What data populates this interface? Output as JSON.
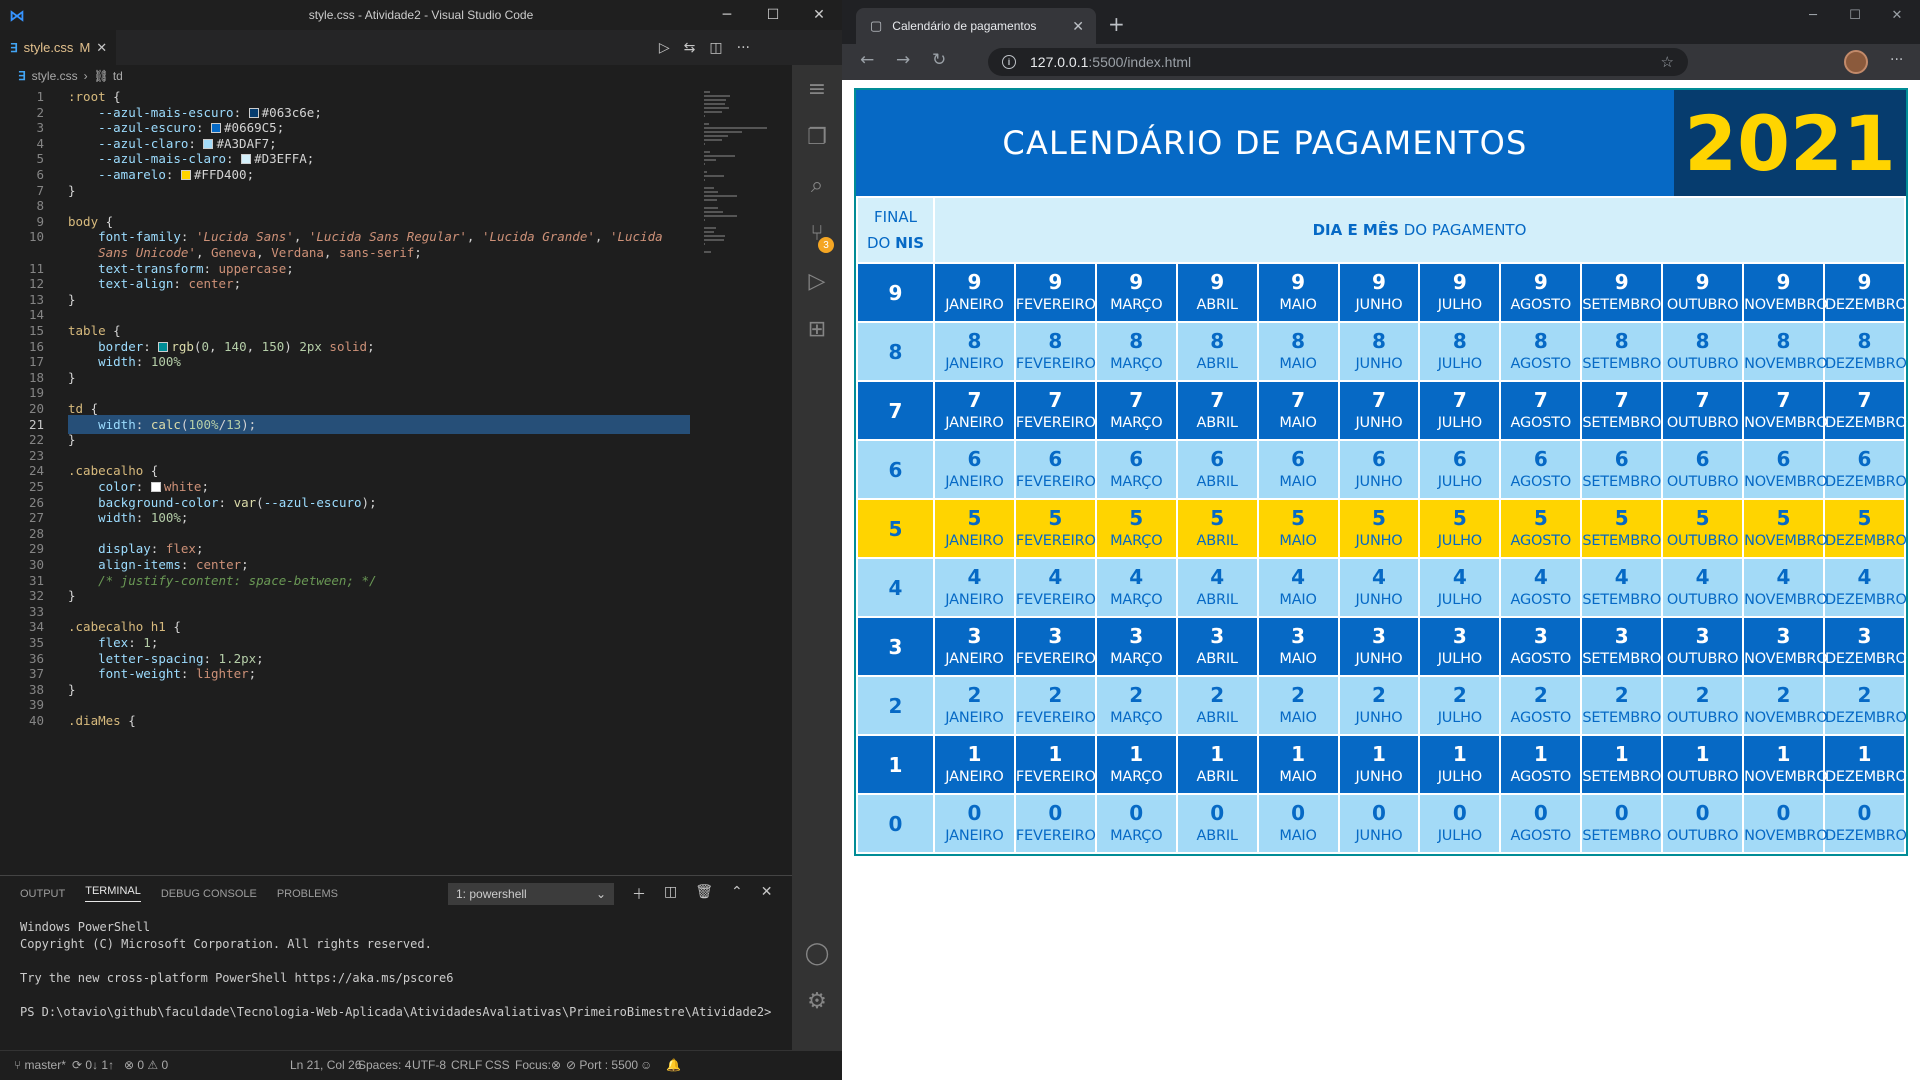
{
  "vscode": {
    "title": "style.css - Atividade2 - Visual Studio Code",
    "tab": {
      "filename": "style.css",
      "modified": "M"
    },
    "breadcrumb": {
      "file": "style.css",
      "symbol": "td"
    },
    "code_lines": [
      {
        "n": "1",
        "html": "<span class=\"c-sel\">:root</span> <span class=\"c-p\">{</span>"
      },
      {
        "n": "2",
        "html": "    <span class=\"c-prop\">--azul-mais-escuro</span><span class=\"c-p\">:</span> <span class=\"swatch\" style=\"background:#063c6e\"></span><span class=\"c-p\">#063c6e;</span>"
      },
      {
        "n": "3",
        "html": "    <span class=\"c-prop\">--azul-escuro</span><span class=\"c-p\">:</span> <span class=\"swatch\" style=\"background:#0669C5\"></span><span class=\"c-p\">#0669C5;</span>"
      },
      {
        "n": "4",
        "html": "    <span class=\"c-prop\">--azul-claro</span><span class=\"c-p\">:</span> <span class=\"swatch\" style=\"background:#A3DAF7\"></span><span class=\"c-p\">#A3DAF7;</span>"
      },
      {
        "n": "5",
        "html": "    <span class=\"c-prop\">--azul-mais-claro</span><span class=\"c-p\">:</span> <span class=\"swatch\" style=\"background:#D3EFFA\"></span><span class=\"c-p\">#D3EFFA;</span>"
      },
      {
        "n": "6",
        "html": "    <span class=\"c-prop\">--amarelo</span><span class=\"c-p\">:</span> <span class=\"swatch\" style=\"background:#FFD400\"></span><span class=\"c-p\">#FFD400;</span>"
      },
      {
        "n": "7",
        "html": "<span class=\"c-p\">}</span>"
      },
      {
        "n": "8",
        "html": ""
      },
      {
        "n": "9",
        "html": "<span class=\"c-sel\">body</span> <span class=\"c-p\">{</span>"
      },
      {
        "n": "10",
        "html": "    <span class=\"c-prop\">font-family</span><span class=\"c-p\">:</span> <span class=\"c-str\"><i>'Lucida Sans'</i></span><span class=\"c-p\">,</span> <span class=\"c-str\"><i>'Lucida Sans Regular'</i></span><span class=\"c-p\">,</span> <span class=\"c-str\"><i>'Lucida Grande'</i></span><span class=\"c-p\">,</span> <span class=\"c-str\"><i>'Lucida</i></span>"
      },
      {
        "n": "",
        "html": "    <span class=\"c-str\"><i>Sans Unicode'</i></span><span class=\"c-p\">,</span> <span class=\"c-val\">Geneva</span><span class=\"c-p\">,</span> <span class=\"c-val\">Verdana</span><span class=\"c-p\">,</span> <span class=\"c-val\">sans-serif</span><span class=\"c-p\">;</span>"
      },
      {
        "n": "11",
        "html": "    <span class=\"c-prop\">text-transform</span><span class=\"c-p\">:</span> <span class=\"c-val\">uppercase</span><span class=\"c-p\">;</span>"
      },
      {
        "n": "12",
        "html": "    <span class=\"c-prop\">text-align</span><span class=\"c-p\">:</span> <span class=\"c-val\">center</span><span class=\"c-p\">;</span>"
      },
      {
        "n": "13",
        "html": "<span class=\"c-p\">}</span>"
      },
      {
        "n": "14",
        "html": ""
      },
      {
        "n": "15",
        "html": "<span class=\"c-sel\">table</span> <span class=\"c-p\">{</span>"
      },
      {
        "n": "16",
        "html": "    <span class=\"c-prop\">border</span><span class=\"c-p\">:</span> <span class=\"swatch\" style=\"background:rgb(0,140,150)\"></span><span class=\"c-fn\">rgb</span><span class=\"c-p\">(</span><span class=\"c-num\">0</span><span class=\"c-p\">,</span> <span class=\"c-num\">140</span><span class=\"c-p\">,</span> <span class=\"c-num\">150</span><span class=\"c-p\">)</span> <span class=\"c-num\">2px</span> <span class=\"c-val\">solid</span><span class=\"c-p\">;</span>"
      },
      {
        "n": "17",
        "html": "    <span class=\"c-prop\">width</span><span class=\"c-p\">:</span> <span class=\"c-num\">100%</span>"
      },
      {
        "n": "18",
        "html": "<span class=\"c-p\">}</span>"
      },
      {
        "n": "19",
        "html": ""
      },
      {
        "n": "20",
        "html": "<span class=\"c-sel\">td</span> <span class=\"c-p\">{</span>"
      },
      {
        "n": "21",
        "html": "    <span class=\"c-prop\">width</span><span class=\"c-p\">:</span> <span class=\"c-fn\">calc</span><span class=\"c-p\">(</span><span class=\"c-num\">100%</span><span class=\"c-p\">/</span><span class=\"c-num\">13</span><span class=\"c-p\">);</span>",
        "active": true
      },
      {
        "n": "22",
        "html": "<span class=\"c-p\">}</span>"
      },
      {
        "n": "23",
        "html": ""
      },
      {
        "n": "24",
        "html": "<span class=\"c-sel\">.cabecalho</span> <span class=\"c-p\">{</span>"
      },
      {
        "n": "25",
        "html": "    <span class=\"c-prop\">color</span><span class=\"c-p\">:</span> <span class=\"swatch\" style=\"background:#ffffff\"></span><span class=\"c-val\">white</span><span class=\"c-p\">;</span>"
      },
      {
        "n": "26",
        "html": "    <span class=\"c-prop\">background-color</span><span class=\"c-p\">:</span> <span class=\"c-fn\">var</span><span class=\"c-p\">(</span><span class=\"c-prop\">--azul-escuro</span><span class=\"c-p\">);</span>"
      },
      {
        "n": "27",
        "html": "    <span class=\"c-prop\">width</span><span class=\"c-p\">:</span> <span class=\"c-num\">100%</span><span class=\"c-p\">;</span>"
      },
      {
        "n": "28",
        "html": ""
      },
      {
        "n": "29",
        "html": "    <span class=\"c-prop\">display</span><span class=\"c-p\">:</span> <span class=\"c-val\">flex</span><span class=\"c-p\">;</span>"
      },
      {
        "n": "30",
        "html": "    <span class=\"c-prop\">align-items</span><span class=\"c-p\">:</span> <span class=\"c-val\">center</span><span class=\"c-p\">;</span>"
      },
      {
        "n": "31",
        "html": "    <span class=\"c-com\">/* justify-content: space-between; */</span>"
      },
      {
        "n": "32",
        "html": "<span class=\"c-p\">}</span>"
      },
      {
        "n": "33",
        "html": ""
      },
      {
        "n": "34",
        "html": "<span class=\"c-sel\">.cabecalho h1</span> <span class=\"c-p\">{</span>"
      },
      {
        "n": "35",
        "html": "    <span class=\"c-prop\">flex</span><span class=\"c-p\">:</span> <span class=\"c-num\">1</span><span class=\"c-p\">;</span>"
      },
      {
        "n": "36",
        "html": "    <span class=\"c-prop\">letter-spacing</span><span class=\"c-p\">:</span> <span class=\"c-num\">1.2px</span><span class=\"c-p\">;</span>"
      },
      {
        "n": "37",
        "html": "    <span class=\"c-prop\">font-weight</span><span class=\"c-p\">:</span> <span class=\"c-val\">lighter</span><span class=\"c-p\">;</span>"
      },
      {
        "n": "38",
        "html": "<span class=\"c-p\">}</span>"
      },
      {
        "n": "39",
        "html": ""
      },
      {
        "n": "40",
        "html": "<span class=\"c-sel\">.diaMes</span> <span class=\"c-p\">{</span>"
      }
    ],
    "panel": {
      "tabs": [
        "OUTPUT",
        "TERMINAL",
        "DEBUG CONSOLE",
        "PROBLEMS"
      ],
      "active_tab": "TERMINAL",
      "terminal_select": "1: powershell",
      "terminal_lines": [
        "Windows PowerShell",
        "Copyright (C) Microsoft Corporation. All rights reserved.",
        "",
        "Try the new cross-platform PowerShell https://aka.ms/pscore6",
        "",
        "PS D:\\otavio\\github\\faculdade\\Tecnologia-Web-Aplicada\\AtividadesAvaliativas\\PrimeiroBimestre\\Atividade2>"
      ]
    },
    "status": {
      "branch": "master*",
      "sync": "0↓ 1↑",
      "problems": "⊗ 0 ⚠ 0",
      "cursor": "Ln 21, Col 26",
      "spaces": "Spaces: 4",
      "encoding": "UTF-8",
      "eol": "CRLF",
      "language": "CSS",
      "focus": "Focus:⊗",
      "port": "⊘ Port : 5500"
    },
    "scm_badge": "3"
  },
  "browser": {
    "tab_title": "Calendário de pagamentos",
    "url_host": "127.0.0.1",
    "url_path": ":5500/index.html"
  },
  "page": {
    "title": "CALENDÁRIO DE PAGAMENTOS",
    "year": "2021",
    "head_nis_line1": "FINAL",
    "head_nis_do": "DO",
    "head_nis_bold": "NIS",
    "head_dia_bold": "DIA E MÊS",
    "head_dia_rest": "DO PAGAMENTO",
    "months": [
      "JANEIRO",
      "FEVEREIRO",
      "MARÇO",
      "ABRIL",
      "MAIO",
      "JUNHO",
      "JULHO",
      "AGOSTO",
      "SETEMBRO",
      "OUTUBRO",
      "NOVEMBRO",
      "DEZEMBRO"
    ],
    "rows": [
      {
        "nis": "9",
        "style": "escuro"
      },
      {
        "nis": "8",
        "style": "claro"
      },
      {
        "nis": "7",
        "style": "escuro"
      },
      {
        "nis": "6",
        "style": "claro"
      },
      {
        "nis": "5",
        "style": "amarelo"
      },
      {
        "nis": "4",
        "style": "claro"
      },
      {
        "nis": "3",
        "style": "escuro"
      },
      {
        "nis": "2",
        "style": "claro"
      },
      {
        "nis": "1",
        "style": "escuro"
      },
      {
        "nis": "0",
        "style": "claro"
      }
    ],
    "colors": {
      "azul_mais_escuro": "#063c6e",
      "azul_escuro": "#0669C5",
      "azul_claro": "#A3DAF7",
      "azul_mais_claro": "#D3EFFA",
      "amarelo": "#FFD400"
    }
  }
}
